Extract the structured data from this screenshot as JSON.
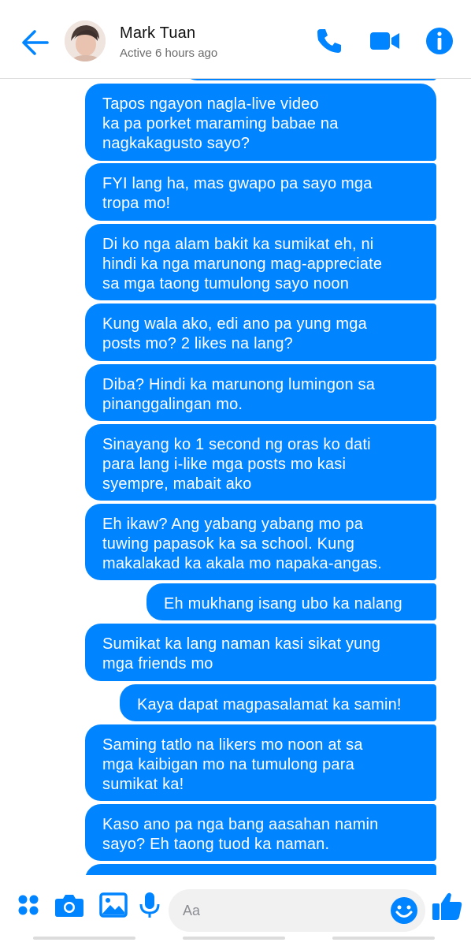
{
  "header": {
    "name": "Mark Tuan",
    "status": "Active 6 hours ago"
  },
  "messages": [
    {
      "text": "Tapos ngayon nagla-live video\nka pa porket maraming babae na\nnagkakagusto sayo?"
    },
    {
      "text": "FYI lang ha, mas gwapo pa sayo mga\ntropa mo!"
    },
    {
      "text": "Di ko nga alam bakit ka sumikat eh, ni\nhindi ka nga marunong mag-appreciate\nsa mga taong tumulong sayo noon"
    },
    {
      "text": "Kung wala ako, edi ano pa yung mga\nposts mo? 2 likes na lang?"
    },
    {
      "text": "Diba? Hindi ka marunong lumingon sa\npinanggalingan mo."
    },
    {
      "text": "Sinayang ko 1 second ng oras ko dati\npara lang i-like mga posts mo kasi\nsyempre, mabait ako"
    },
    {
      "text": "Eh ikaw? Ang yabang yabang mo pa\ntuwing papasok ka sa school. Kung\nmakalakad ka akala mo napaka-angas."
    },
    {
      "text": "Eh mukhang isang ubo ka nalang"
    },
    {
      "text": "Sumikat ka lang naman kasi sikat yung\nmga friends mo"
    },
    {
      "text": "Kaya dapat magpasalamat ka samin!"
    },
    {
      "text": "Saming tatlo na likers mo noon at sa\nmga kaibigan mo na tumulong para\nsumikat ka!"
    },
    {
      "text": "Kaso ano pa nga bang aasahan namin\nsayo? Eh taong tuod ka naman."
    }
  ],
  "composer": {
    "placeholder": "Aa"
  },
  "colors": {
    "accent": "#0084ff",
    "bubble_text": "#ffffff"
  },
  "icons": {
    "back": "arrow-left-icon",
    "phone": "phone-icon",
    "video": "video-camera-icon",
    "info": "info-icon",
    "apps": "four-dots-icon",
    "camera": "camera-icon",
    "gallery": "image-icon",
    "mic": "microphone-icon",
    "emoji": "emoji-icon",
    "like": "thumbs-up-icon"
  }
}
